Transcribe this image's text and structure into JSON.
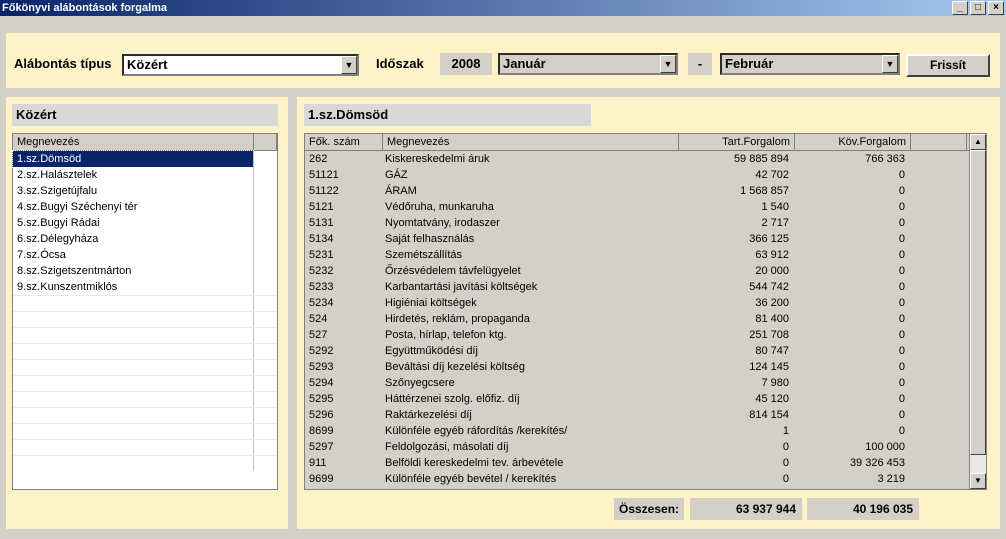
{
  "window": {
    "title": "Főkönyvi alábontások forgalma",
    "min": "_",
    "max": "□",
    "close": "×"
  },
  "toolbar": {
    "type_label": "Alábontás típus",
    "type_value": "Közért",
    "period_label": "Időszak",
    "year": "2008",
    "from_month": "Január",
    "dash": "-",
    "to_month": "Február",
    "refresh_label": "Frissít"
  },
  "left": {
    "header": "Közért",
    "column": "Megnevezés",
    "items": [
      "1.sz.Dömsöd",
      "2.sz.Halásztelek",
      "3.sz.Szigetújfalu",
      "4.sz.Bugyi Széchenyi tér",
      "5.sz.Bugyi Rádai",
      "6.sz.Délegyháza",
      "7.sz.Ócsa",
      "8.sz.Szigetszentmárton",
      "9.sz.Kunszentmiklós"
    ]
  },
  "right": {
    "header": "1.sz.Dömsöd",
    "columns": [
      "Fők. szám",
      "Megnevezés",
      "Tart.Forgalom",
      "Köv.Forgalom"
    ],
    "rows": [
      [
        "262",
        "Kiskereskedelmi áruk",
        "59 885 894",
        "766 363"
      ],
      [
        "51121",
        "GÁZ",
        "42 702",
        "0"
      ],
      [
        "51122",
        "ÁRAM",
        "1 568 857",
        "0"
      ],
      [
        "5121",
        "Védőruha, munkaruha",
        "1 540",
        "0"
      ],
      [
        "5131",
        "Nyomtatvány, irodaszer",
        "2 717",
        "0"
      ],
      [
        "5134",
        "Saját felhasználás",
        "366 125",
        "0"
      ],
      [
        "5231",
        "Szemétszállítás",
        "63 912",
        "0"
      ],
      [
        "5232",
        "Őrzésvédelem távfelügyelet",
        "20 000",
        "0"
      ],
      [
        "5233",
        "Karbantartási javítási költségek",
        "544 742",
        "0"
      ],
      [
        "5234",
        "Higiéniai költségek",
        "36 200",
        "0"
      ],
      [
        "524",
        "Hirdetés, reklám, propaganda",
        "81 400",
        "0"
      ],
      [
        "527",
        "Posta, hírlap, telefon ktg.",
        "251 708",
        "0"
      ],
      [
        "5292",
        "Együttműködési díj",
        "80 747",
        "0"
      ],
      [
        "5293",
        "Beváltási díj kezelési költség",
        "124 145",
        "0"
      ],
      [
        "5294",
        "Szőnyegcsere",
        "7 980",
        "0"
      ],
      [
        "5295",
        "Háttérzenei szolg. előfiz. díj",
        "45 120",
        "0"
      ],
      [
        "5296",
        "Raktárkezelési díj",
        "814 154",
        "0"
      ],
      [
        "8699",
        "Különféle egyéb ráfordítás /kerekítés/",
        "1",
        "0"
      ],
      [
        "5297",
        "Feldolgozási, másolati díj",
        "0",
        "100 000"
      ],
      [
        "911",
        "Belföldi kereskedelmi tev. árbevétele",
        "0",
        "39 326 453"
      ],
      [
        "9699",
        "Különféle egyéb bevétel / kerekítés",
        "0",
        "3 219"
      ]
    ],
    "total_label": "Összesen:",
    "total_tart": "63 937 944",
    "total_kov": "40 196 035"
  }
}
